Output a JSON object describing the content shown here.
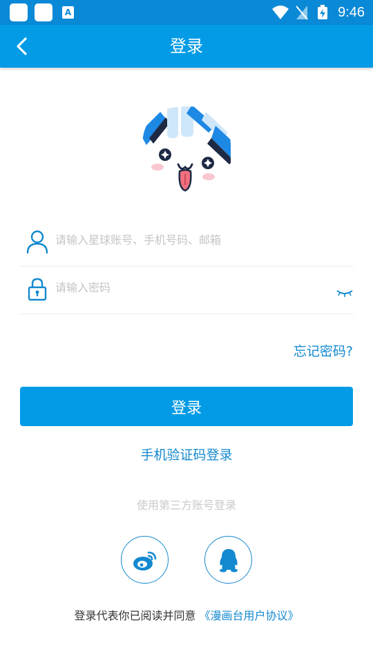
{
  "status_bar": {
    "time": "9:46"
  },
  "header": {
    "title": "登录"
  },
  "form": {
    "account_placeholder": "请输入星球账号、手机号码、邮箱",
    "password_placeholder": "请输入密码",
    "forgot_password": "忘记密码?",
    "login_button": "登录",
    "sms_login": "手机验证码登录"
  },
  "third_party": {
    "label": "使用第三方账号登录",
    "providers": [
      "weibo",
      "qq"
    ]
  },
  "agreement": {
    "prefix": "登录代表你已阅读并同意",
    "link": "《漫画台用户协议》"
  },
  "colors": {
    "primary": "#039be5",
    "status_bar": "#0a89d6",
    "link": "#1389cf"
  }
}
